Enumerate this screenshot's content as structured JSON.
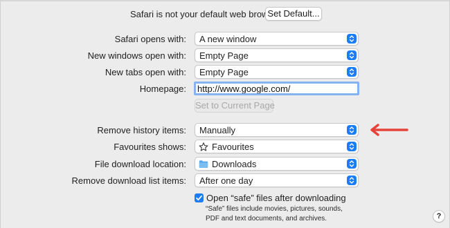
{
  "default_browser": {
    "message": "Safari is not your default web browser.",
    "set_default_label": "Set Default..."
  },
  "settings": {
    "safari_opens_with": {
      "label": "Safari opens with:",
      "value": "A new window"
    },
    "new_windows_open_with": {
      "label": "New windows open with:",
      "value": "Empty Page"
    },
    "new_tabs_open_with": {
      "label": "New tabs open with:",
      "value": "Empty Page"
    },
    "homepage": {
      "label": "Homepage:",
      "value": "http://www.google.com/"
    },
    "set_to_current_page_label": "Set to Current Page",
    "remove_history_items": {
      "label": "Remove history items:",
      "value": "Manually"
    },
    "favourites_shows": {
      "label": "Favourites shows:",
      "value": "Favourites",
      "icon": "star-icon"
    },
    "file_download_location": {
      "label": "File download location:",
      "value": "Downloads",
      "icon": "folder-icon"
    },
    "remove_download_list_items": {
      "label": "Remove download list items:",
      "value": "After one day"
    },
    "open_safe_files": {
      "label": "Open “safe” files after downloading",
      "checked": true,
      "help_line1": "“Safe” files include movies, pictures, sounds,",
      "help_line2": "PDF and text documents, and archives."
    }
  },
  "help_button_label": "?",
  "colors": {
    "accent": "#1c7cf4",
    "annotation_arrow": "#e8433b"
  }
}
